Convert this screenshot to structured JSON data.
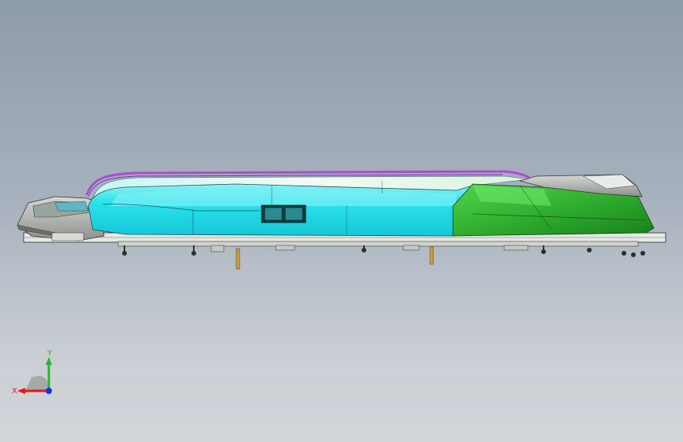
{
  "viewport": {
    "colors": {
      "background_top": "#8e9bab",
      "background_bottom": "#d3d6da",
      "cyan_body": "#1ee3ec",
      "green_body": "#2db52c",
      "magenta_edge": "#b04ad0",
      "grey_part": "#b9bcba",
      "rail": "#e4e6e2"
    }
  },
  "triad": {
    "x_label": "X",
    "y_label": "Y",
    "x_color": "#e01919",
    "y_color": "#2ab52a",
    "z_color": "#1a2fe0"
  }
}
